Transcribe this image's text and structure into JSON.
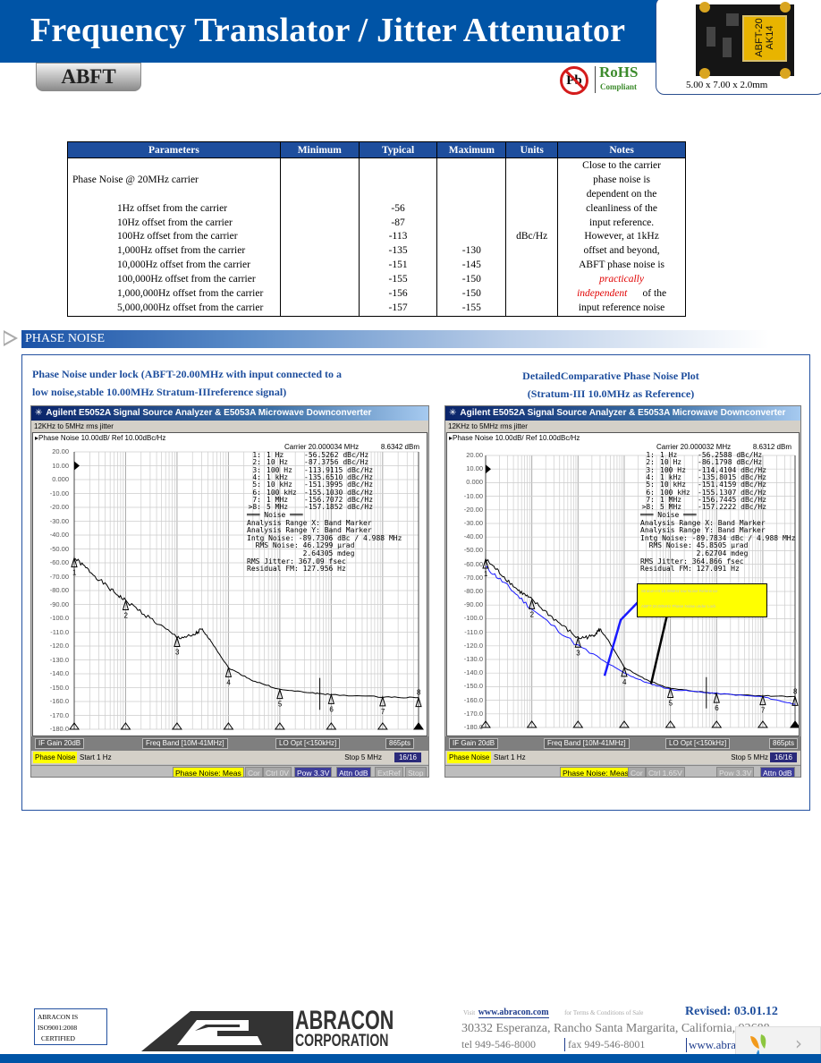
{
  "header": {
    "title": "Frequency Translator / Jitter Attenuator",
    "product": "ABFT",
    "rohs": "RoHS",
    "compliant": "Compliant",
    "pb": "Pb",
    "chip_marking": [
      "ABFT-20",
      "AK14"
    ],
    "dimensions": "5.00 x 7.00 x 2.0mm"
  },
  "table": {
    "headers": [
      "Parameters",
      "Minimum",
      "Typical",
      "Maximum",
      "Units",
      "Notes"
    ],
    "parameter_title": "Phase Noise @ 20MHz carrier",
    "rows": [
      {
        "param": "1Hz offset from the carrier",
        "typical": "-56",
        "maximum": ""
      },
      {
        "param": "10Hz offset from the carrier",
        "typical": "-87",
        "maximum": ""
      },
      {
        "param": "100Hz offset from the carrier",
        "typical": "-113",
        "maximum": ""
      },
      {
        "param": "1,000Hz offset from the carrier",
        "typical": "-135",
        "maximum": "-130"
      },
      {
        "param": "10,000Hz offset from the carrier",
        "typical": "-151",
        "maximum": "-145"
      },
      {
        "param": "100,000Hz offset from the carrier",
        "typical": "-155",
        "maximum": "-150"
      },
      {
        "param": "1,000,000Hz offset from the carrier",
        "typical": "-156",
        "maximum": "-150"
      },
      {
        "param": "5,000,000Hz offset from the carrier",
        "typical": "-157",
        "maximum": "-155"
      }
    ],
    "units": "dBc/Hz",
    "notes": [
      "Close to the carrier",
      "phase noise is",
      "dependent on the",
      "cleanliness of the",
      "input reference.",
      "However, at 1kHz",
      "offset and beyond,",
      "ABFT phase noise is",
      "practically",
      "independent",
      "of the",
      "input reference noise"
    ]
  },
  "section": {
    "title": "PHASE NOISE"
  },
  "captions": {
    "left": [
      "Phase Noise under lock (ABFT-20.00MHz with input connected to a",
      "low noise,stable 10.00MHz Stratum-IIIreference signal)"
    ],
    "right": [
      "DetailedComparative Phase Noise Plot",
      "(Stratum-III 10.0MHz as Reference)"
    ]
  },
  "plots": [
    {
      "window_title": "Agilent E5052A Signal Source Analyzer & E5053A Microwave Downconverter",
      "subtitle": "12KHz to 5MHz rms jitter",
      "trace_header": "▸Phase Noise 10.00dB/ Ref 10.00dBc/Hz",
      "carrier": "Carrier 20.000034 MHz",
      "power": "8.6342 dBm",
      "y_ticks": [
        "20.00",
        "10.00",
        "0.000",
        "-10.00",
        "-20.00",
        "-30.00",
        "-40.00",
        "-50.00",
        "-60.00",
        "-70.00",
        "-80.00",
        "-90.00",
        "-100.0",
        "-110.0",
        "-120.0",
        "-130.0",
        "-140.0",
        "-150.0",
        "-160.0",
        "-170.0",
        "-180.0"
      ],
      "markers": [
        {
          "id": "1:",
          "freq": "1 Hz",
          "value": "-56.5262 dBc/Hz"
        },
        {
          "id": "2:",
          "freq": "10 Hz",
          "value": "-87.3756 dBc/Hz"
        },
        {
          "id": "3:",
          "freq": "100 Hz",
          "value": "-113.9115 dBc/Hz"
        },
        {
          "id": "4:",
          "freq": "1 kHz",
          "value": "-135.6510 dBc/Hz"
        },
        {
          "id": "5:",
          "freq": "10 kHz",
          "value": "-151.3995 dBc/Hz"
        },
        {
          "id": "6:",
          "freq": "100 kHz",
          "value": "-155.1030 dBc/Hz"
        },
        {
          "id": "7:",
          "freq": "1 MHz",
          "value": "-156.7072 dBc/Hz"
        },
        {
          "id": ">8:",
          "freq": "5 MHz",
          "value": "-157.1852 dBc/Hz"
        }
      ],
      "noise_lines": [
        "═══ Noise ═══",
        "Analysis Range X: Band Marker",
        "Analysis Range Y: Band Marker",
        "Intg Noise: -89.7306 dBc / 4.988 MHz",
        "  RMS Noise: 46.1299 µrad",
        "             2.64305 mdeg",
        "RMS Jitter: 367.09 fsec",
        "Residual FM: 127.956 Hz"
      ],
      "status": [
        "IF Gain 20dB",
        "Freq Band [10M-41MHz]",
        "LO Opt [<150kHz]",
        "865pts"
      ],
      "mode": "Phase Noise",
      "start": "Start 1 Hz",
      "stop": "Stop 5 MHz",
      "page": "16/16",
      "softkeys": [
        "Phase Noise: Meas",
        "Cor",
        "Ctrl 0V",
        "Pow 3.3V",
        "Attn 0dB",
        "ExtRef",
        "Stop"
      ],
      "traces": [
        {
          "color": "#000000",
          "points": [
            [
              1,
              -56.5
            ],
            [
              2,
              -66
            ],
            [
              5,
              -79
            ],
            [
              10,
              -87.4
            ],
            [
              30,
              -100
            ],
            [
              100,
              -113.9
            ],
            [
              200,
              -113
            ],
            [
              300,
              -108
            ],
            [
              450,
              -116
            ],
            [
              1000,
              -135.7
            ],
            [
              3000,
              -145
            ],
            [
              10000,
              -151.4
            ],
            [
              50000,
              -154
            ],
            [
              100000,
              -155.1
            ],
            [
              1000000,
              -156.7
            ],
            [
              5000000,
              -157.2
            ]
          ]
        }
      ]
    },
    {
      "window_title": "Agilent E5052A Signal Source Analyzer & E5053A Microwave Downconverter",
      "subtitle": "12KHz to 5MHz rms jitter",
      "trace_header": "▸Phase Noise 10.00dB/ Ref 10.00dBc/Hz",
      "carrier": "Carrier 20.000032 MHz",
      "power": "8.6312 dBm",
      "y_ticks": [
        "20.00",
        "10.00",
        "0.000",
        "-10.00",
        "-20.00",
        "-30.00",
        "-40.00",
        "-50.00",
        "-60.00",
        "-70.00",
        "-80.00",
        "-90.00",
        "-100.0",
        "-110.0",
        "-120.0",
        "-130.0",
        "-140.0",
        "-150.0",
        "-160.0",
        "-170.0",
        "-180.0"
      ],
      "markers": [
        {
          "id": "1:",
          "freq": "1 Hz",
          "value": "-56.2588 dBc/Hz"
        },
        {
          "id": "2:",
          "freq": "10 Hz",
          "value": "-86.1798 dBc/Hz"
        },
        {
          "id": "3:",
          "freq": "100 Hz",
          "value": "-114.4104 dBc/Hz"
        },
        {
          "id": "4:",
          "freq": "1 kHz",
          "value": "-135.8015 dBc/Hz"
        },
        {
          "id": "5:",
          "freq": "10 kHz",
          "value": "-151.4159 dBc/Hz"
        },
        {
          "id": "6:",
          "freq": "100 kHz",
          "value": "-155.1307 dBc/Hz"
        },
        {
          "id": "7:",
          "freq": "1 MHz",
          "value": "-156.7445 dBc/Hz"
        },
        {
          "id": ">8:",
          "freq": "5 MHz",
          "value": "-157.2222 dBc/Hz"
        }
      ],
      "noise_lines": [
        "═══ Noise ═══",
        "Analysis Range X: Band Marker",
        "Analysis Range Y: Band Marker",
        "Intg Noise: -89.7834 dBc / 4.988 MHz",
        "  RMS Noise: 45.8505 µrad",
        "             2.62704 mdeg",
        "RMS Jitter: 364.866 fsec",
        "Residual FM: 127.091 Hz"
      ],
      "status": [
        "IF Gain 20dB",
        "Freq Band [10M-41MHz]",
        "LO Opt [<150kHz]",
        "865pts"
      ],
      "mode": "Phase Noise",
      "start": "Start 1 Hz",
      "stop": "Stop 5 MHz",
      "page": "16/16",
      "softkeys": [
        "Phase Noise: Meas",
        "Cor",
        "Ctrl 1.65V",
        "Pow 3.3V",
        "Attn 0dB",
        "ExtRef",
        "Stop"
      ],
      "annotation": [
        "Stratum-III 10.00MHz low Noise Reference",
        "ABFT-20.00MHz Phase Noise under Lock"
      ],
      "traces": [
        {
          "color": "#000000",
          "points": [
            [
              1,
              -56.3
            ],
            [
              2,
              -66
            ],
            [
              5,
              -79
            ],
            [
              10,
              -86.2
            ],
            [
              30,
              -100
            ],
            [
              100,
              -114.4
            ],
            [
              200,
              -113
            ],
            [
              300,
              -108
            ],
            [
              450,
              -116
            ],
            [
              1000,
              -135.8
            ],
            [
              3000,
              -145
            ],
            [
              10000,
              -151.4
            ],
            [
              50000,
              -154
            ],
            [
              100000,
              -155.1
            ],
            [
              1000000,
              -156.7
            ],
            [
              5000000,
              -157.2
            ]
          ]
        },
        {
          "color": "#1a1aff",
          "points": [
            [
              1,
              -62
            ],
            [
              3,
              -76
            ],
            [
              10,
              -93
            ],
            [
              100,
              -120
            ],
            [
              1000,
              -140
            ],
            [
              3000,
              -147
            ],
            [
              10000,
              -152
            ],
            [
              100000,
              -155
            ],
            [
              1000000,
              -157.5
            ],
            [
              5000000,
              -163
            ]
          ]
        }
      ]
    }
  ],
  "footer": {
    "iso": [
      "ABRACON IS",
      "ISO9001:2008",
      "CERTIFIED"
    ],
    "company": "ABRACON",
    "company_sub": "CORPORATION",
    "visit_pre": "Visit",
    "visit_url": "www.abracon.com",
    "visit_post": "for Terms & Conditions of Sale",
    "revised": "Revised: 03.01.12",
    "address": "30332 Esperanza, Rancho Santa Margarita, California, 92688",
    "tel": "tel 949-546-8000",
    "fax": "fax 949-546-8001",
    "web": "www.abracon.com"
  },
  "colors": {
    "brand_blue": "#0054a6",
    "table_header": "#1e4e9d",
    "rohs_green": "#3c8b2c",
    "highlight_yellow": "#ffff00"
  }
}
